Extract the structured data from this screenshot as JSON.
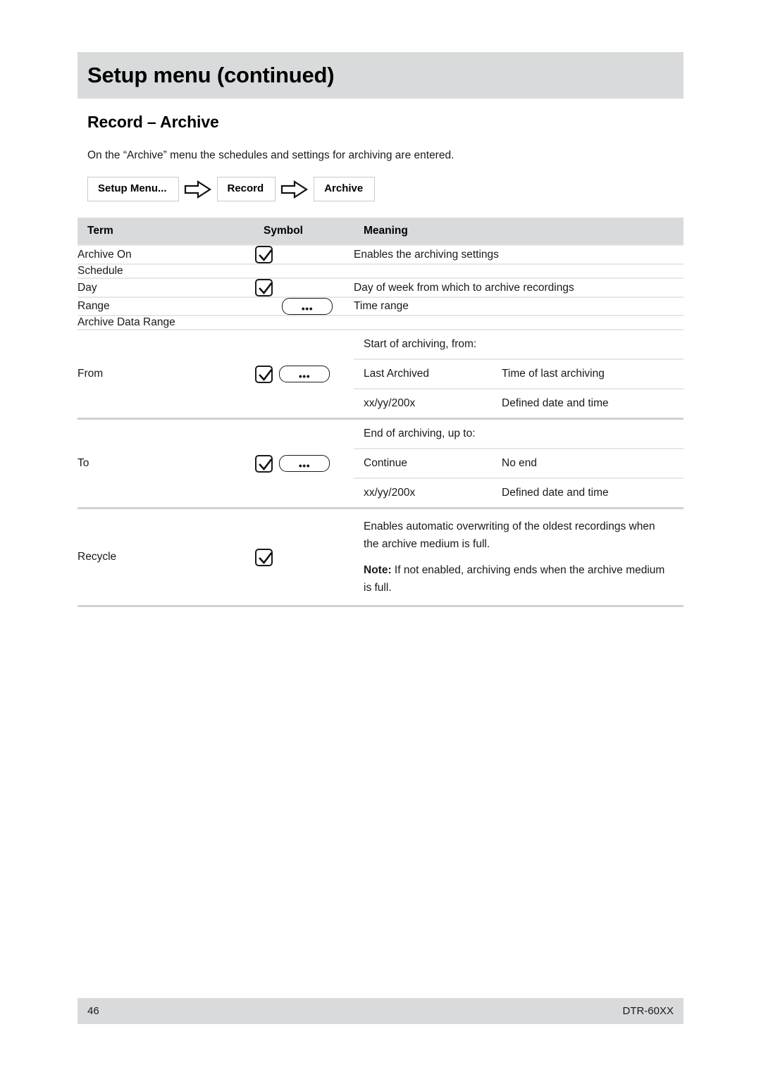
{
  "header": {
    "title": "Setup menu (continued)"
  },
  "section": {
    "heading": "Record – Archive",
    "intro": "On the “Archive” menu the schedules and settings for archiving are entered."
  },
  "breadcrumb": {
    "items": [
      "Setup Menu...",
      "Record",
      "Archive"
    ],
    "arrow_icon": "right-arrow-icon"
  },
  "table": {
    "columns": [
      "Term",
      "Symbol",
      "Meaning"
    ],
    "rows": [
      {
        "term": "Archive On",
        "symbol": [
          "checkbox"
        ],
        "meaning": "Enables the archiving settings"
      },
      {
        "term": "Schedule",
        "symbol": [],
        "meaning": ""
      },
      {
        "term": "Day",
        "symbol": [
          "checkbox"
        ],
        "meaning": "Day of week from which to archive recordings"
      },
      {
        "term": "Range",
        "symbol": [
          "ellipsis-button"
        ],
        "meaning": "Time range"
      },
      {
        "term": "Archive Data Range",
        "symbol": [],
        "meaning": ""
      },
      {
        "term": "From",
        "symbol": [
          "checkbox",
          "ellipsis-button"
        ],
        "subrows": [
          {
            "value": "Start of archiving, from:",
            "desc": ""
          },
          {
            "value": "Last Archived",
            "desc": "Time of last archiving"
          },
          {
            "value": "xx/yy/200x",
            "desc": "Defined date and time"
          }
        ]
      },
      {
        "term": "To",
        "symbol": [
          "checkbox",
          "ellipsis-button"
        ],
        "subrows": [
          {
            "value": "End of archiving, up to:",
            "desc": ""
          },
          {
            "value": "Continue",
            "desc": "No end"
          },
          {
            "value": "xx/yy/200x",
            "desc": "Defined date and time"
          }
        ]
      },
      {
        "term": "Recycle",
        "symbol": [
          "checkbox"
        ],
        "meaning_p1": "Enables automatic overwriting of the oldest recordings when the archive medium is full.",
        "meaning_note_label": "Note:",
        "meaning_note_text": " If not enabled, archiving ends when the archive medium is full."
      }
    ]
  },
  "symbols": {
    "ellipsis_label": "•••"
  },
  "footer": {
    "page_number": "46",
    "model": "DTR-60XX"
  },
  "colors": {
    "band_gray": "#d9dadb",
    "separator_light": "#e6e7e8",
    "separator_bold": "#d0d1d2",
    "text": "#1a1a1a"
  }
}
